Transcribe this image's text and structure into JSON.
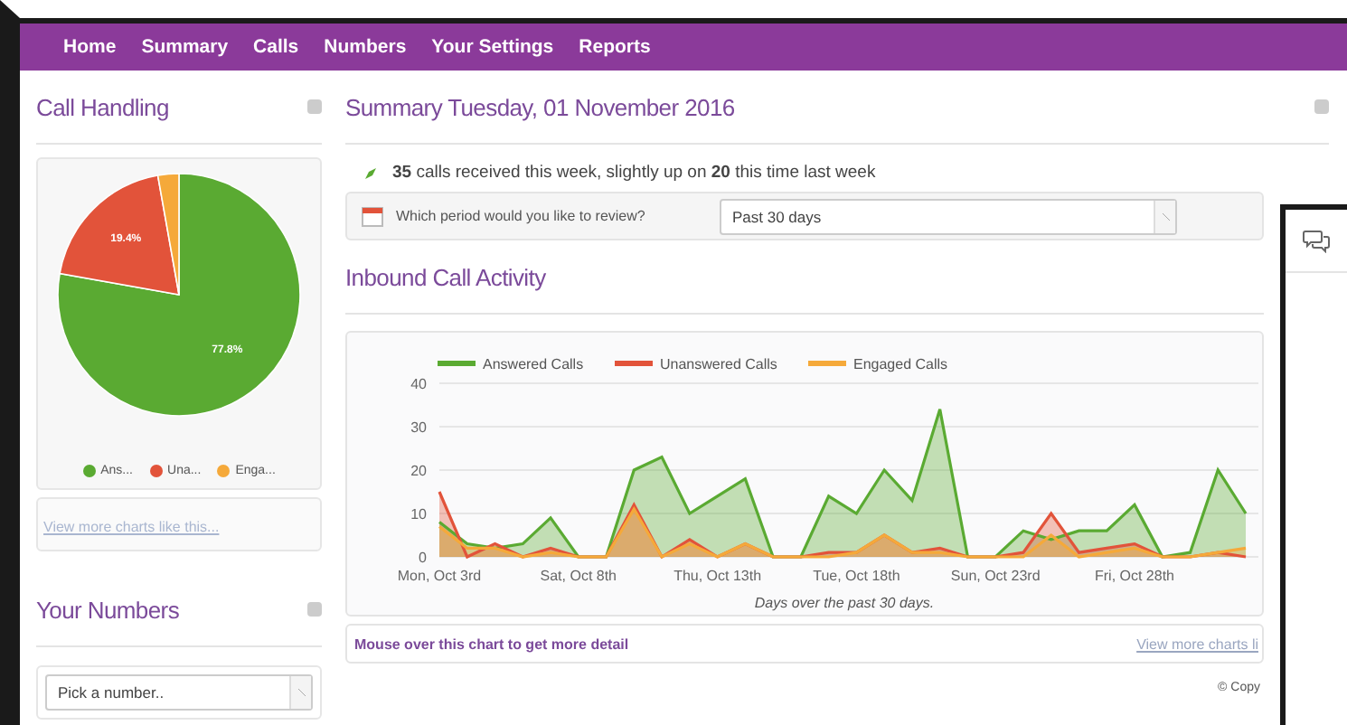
{
  "nav": [
    "Home",
    "Summary",
    "Calls",
    "Numbers",
    "Your Settings",
    "Reports"
  ],
  "call_handling": {
    "title": "Call Handling",
    "chart_data": {
      "type": "pie",
      "categories": [
        "Ans...",
        "Una...",
        "Enga..."
      ],
      "values": [
        77.8,
        19.4,
        2.8
      ],
      "colors": [
        "#5aaa32",
        "#e2533a",
        "#f5a93a"
      ],
      "value_labels": [
        "77.8%",
        "19.4%",
        null
      ]
    },
    "link": "View more charts like this..."
  },
  "your_numbers": {
    "title": "Your Numbers",
    "select": "Pick a number.."
  },
  "summary": {
    "title": "Summary Tuesday, 01 November 2016",
    "stats": "**35** calls received this week, slightly up on **20** this time last week",
    "period_label": "Which period would you like to review?",
    "period_value": "Past 30 days"
  },
  "activity": {
    "title": "Inbound Call Activity",
    "chart_data": {
      "type": "area",
      "categories": [
        "Mon, Oct 3rd",
        null,
        null,
        null,
        null,
        "Sat, Oct 8th",
        null,
        null,
        null,
        null,
        "Thu, Oct 13th",
        null,
        null,
        null,
        null,
        "Tue, Oct 18th",
        null,
        null,
        null,
        null,
        "Sun, Oct 23rd",
        null,
        null,
        null,
        null,
        "Fri, Oct 28th",
        null,
        null,
        null,
        null
      ],
      "xlabel": "Days over the past 30 days.",
      "ylim": [
        0,
        40
      ],
      "yticks": [
        0,
        10,
        20,
        30,
        40
      ],
      "grid": true,
      "legend": "top",
      "series": [
        {
          "name": "Answered Calls",
          "color": "#5aaa32",
          "values": [
            8,
            3,
            2,
            3,
            9,
            0,
            0,
            20,
            23,
            10,
            14,
            18,
            0,
            0,
            14,
            10,
            20,
            13,
            34,
            0,
            0,
            6,
            4,
            6,
            6,
            12,
            0,
            1,
            20,
            10
          ]
        },
        {
          "name": "Unanswered Calls",
          "color": "#e2533a",
          "values": [
            15,
            0,
            3,
            0,
            2,
            0,
            0,
            12,
            0,
            4,
            0,
            3,
            0,
            0,
            1,
            1,
            5,
            1,
            2,
            0,
            0,
            1,
            10,
            1,
            2,
            3,
            0,
            0,
            1,
            0
          ]
        },
        {
          "name": "Engaged Calls",
          "color": "#f5a93a",
          "values": [
            7,
            2,
            2,
            0,
            1,
            0,
            0,
            11,
            0,
            3,
            0,
            3,
            0,
            0,
            0,
            1,
            5,
            1,
            1,
            0,
            0,
            0,
            5,
            0,
            1,
            2,
            0,
            0,
            1,
            2
          ]
        }
      ]
    },
    "hint": "Mouse over this chart to get more detail",
    "link": "View more charts li"
  },
  "copyright": "© Copy"
}
